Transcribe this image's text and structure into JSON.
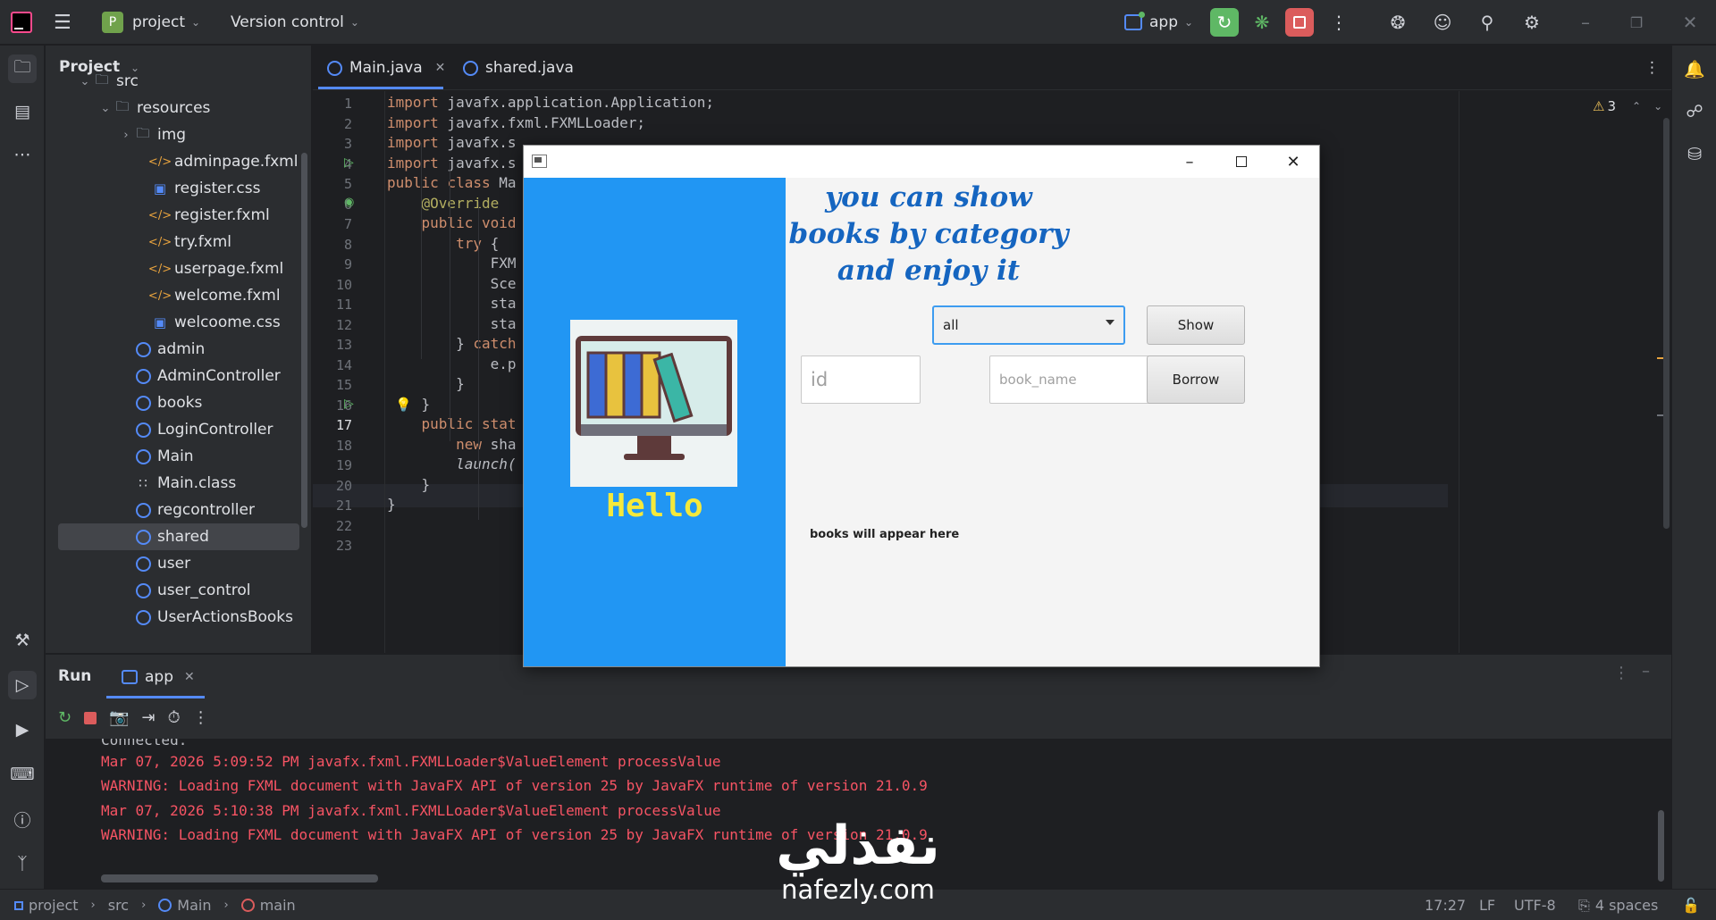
{
  "titlebar": {
    "project_badge": "P",
    "project_name": "project",
    "version_control": "Version control",
    "run_config": "app"
  },
  "project_panel": {
    "title": "Project",
    "tree": [
      {
        "label": "src",
        "kind": "folder",
        "expanded": true
      },
      {
        "label": "resources",
        "kind": "folder",
        "expanded": true
      },
      {
        "label": "img",
        "kind": "folder",
        "expanded": false
      },
      {
        "label": "adminpage.fxml",
        "kind": "fxml"
      },
      {
        "label": "register.css",
        "kind": "css"
      },
      {
        "label": "register.fxml",
        "kind": "fxml"
      },
      {
        "label": "try.fxml",
        "kind": "fxml"
      },
      {
        "label": "userpage.fxml",
        "kind": "fxml"
      },
      {
        "label": "welcome.fxml",
        "kind": "fxml"
      },
      {
        "label": "welcoome.css",
        "kind": "css"
      },
      {
        "label": "admin",
        "kind": "class"
      },
      {
        "label": "AdminController",
        "kind": "class"
      },
      {
        "label": "books",
        "kind": "class"
      },
      {
        "label": "LoginController",
        "kind": "class"
      },
      {
        "label": "Main",
        "kind": "class"
      },
      {
        "label": "Main.class",
        "kind": "binary"
      },
      {
        "label": "regcontroller",
        "kind": "class"
      },
      {
        "label": "shared",
        "kind": "class",
        "selected": true
      },
      {
        "label": "user",
        "kind": "class"
      },
      {
        "label": "user_control",
        "kind": "class"
      },
      {
        "label": "UserActionsBooks",
        "kind": "class"
      }
    ]
  },
  "editor": {
    "tabs": [
      {
        "label": "Main.java",
        "active": true
      },
      {
        "label": "shared.java",
        "active": false
      }
    ],
    "warning_count": "3",
    "lines": [
      {
        "n": "1",
        "text": "import javafx.application.Application;"
      },
      {
        "n": "2",
        "text": "import javafx.fxml.FXMLLoader;"
      },
      {
        "n": "3",
        "text": "import javafx.s"
      },
      {
        "n": "4",
        "text": "import javafx.s"
      },
      {
        "n": "5",
        "text": "public class Ma"
      },
      {
        "n": "6",
        "text": "    @Override"
      },
      {
        "n": "7",
        "text": "    public void"
      },
      {
        "n": "8",
        "text": "        try {"
      },
      {
        "n": "9",
        "text": "            FXM"
      },
      {
        "n": "10",
        "text": "            Sce"
      },
      {
        "n": "11",
        "text": "            sta"
      },
      {
        "n": "12",
        "text": "            sta"
      },
      {
        "n": "13",
        "text": "        } catch"
      },
      {
        "n": "14",
        "text": "            e.p"
      },
      {
        "n": "15",
        "text": "        }"
      },
      {
        "n": "16",
        "text": "    }"
      },
      {
        "n": "17",
        "text": "    public stat"
      },
      {
        "n": "18",
        "text": "        new sha"
      },
      {
        "n": "19",
        "text": "        launch("
      },
      {
        "n": "20",
        "text": "    }"
      },
      {
        "n": "21",
        "text": "}"
      },
      {
        "n": "22",
        "text": ""
      },
      {
        "n": "23",
        "text": ""
      }
    ]
  },
  "run_panel": {
    "title": "Run",
    "tab": "app",
    "partial_line": "Connected.",
    "lines": [
      "Mar 07, 2026 5:09:52 PM javafx.fxml.FXMLLoader$ValueElement processValue",
      "WARNING: Loading FXML document with JavaFX API of version 25 by JavaFX runtime of version 21.0.9",
      "Mar 07, 2026 5:10:38 PM javafx.fxml.FXMLLoader$ValueElement processValue",
      "WARNING: Loading FXML document with JavaFX API of version 25 by JavaFX runtime of version 21.0.9"
    ]
  },
  "statusbar": {
    "breadcrumb": [
      "project",
      "src",
      "Main",
      "main"
    ],
    "position": "17:27",
    "line_ending": "LF",
    "encoding": "UTF-8",
    "indent": "4 spaces"
  },
  "fx_app": {
    "heading": "you can show books by category and enjoy it",
    "hello": "Hello",
    "category_selected": "all",
    "show_label": "Show",
    "borrow_label": "Borrow",
    "id_placeholder": "id",
    "book_name_placeholder": "book_name",
    "books_info": "books will appear here"
  },
  "watermark": {
    "arabic": "نفذلي",
    "latin": "nafezly.com"
  }
}
